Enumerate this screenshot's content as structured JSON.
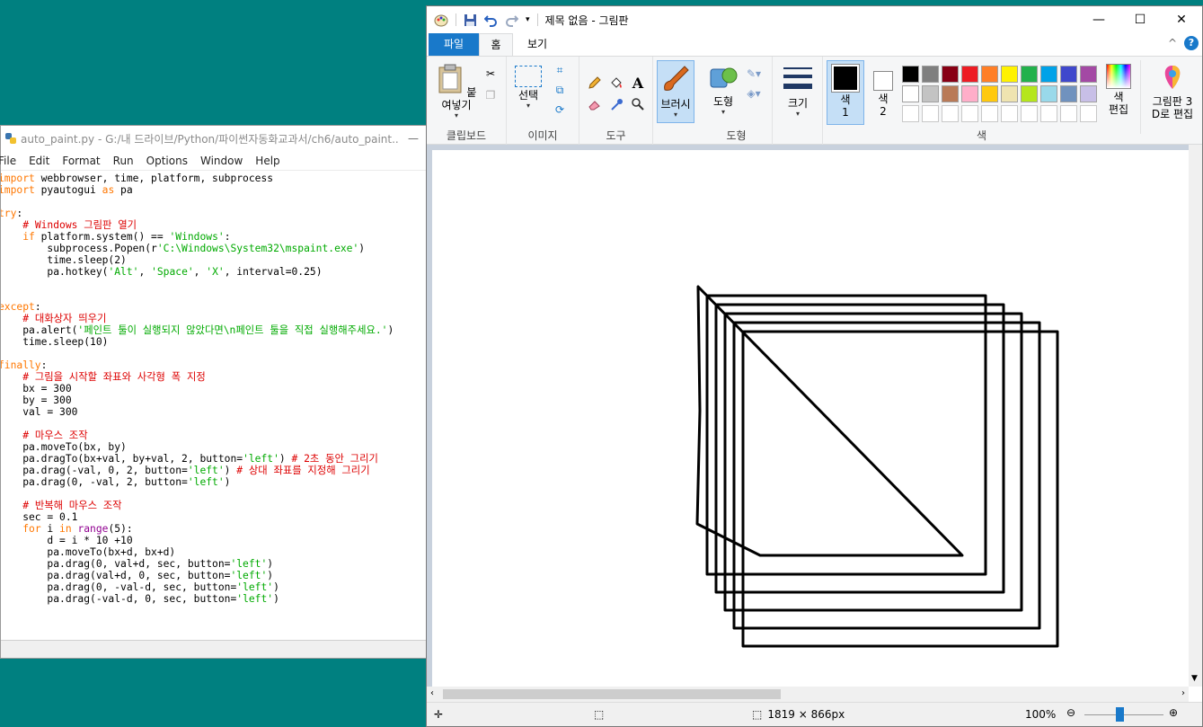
{
  "idle": {
    "title": "auto_paint.py - G:/내 드라이브/Python/파이썬자동화교과서/ch6/auto_paint....",
    "minimize_glyph": "—",
    "menu": [
      "File",
      "Edit",
      "Format",
      "Run",
      "Options",
      "Window",
      "Help"
    ],
    "code_lines": [
      [
        {
          "t": "import",
          "c": "kw"
        },
        {
          "t": " webbrowser, time, platform, subprocess"
        }
      ],
      [
        {
          "t": "import",
          "c": "kw"
        },
        {
          "t": " pyautogui "
        },
        {
          "t": "as",
          "c": "kw"
        },
        {
          "t": " pa"
        }
      ],
      [],
      [
        {
          "t": "try",
          "c": "kw"
        },
        {
          "t": ":"
        }
      ],
      [
        {
          "t": "    "
        },
        {
          "t": "# Windows 그림판 열기",
          "c": "cm"
        }
      ],
      [
        {
          "t": "    "
        },
        {
          "t": "if",
          "c": "kw"
        },
        {
          "t": " platform.system() == "
        },
        {
          "t": "'Windows'",
          "c": "st"
        },
        {
          "t": ":"
        }
      ],
      [
        {
          "t": "        subprocess.Popen(r"
        },
        {
          "t": "'C:\\Windows\\System32\\mspaint.exe'",
          "c": "st"
        },
        {
          "t": ")"
        }
      ],
      [
        {
          "t": "        time.sleep(2)"
        }
      ],
      [
        {
          "t": "        pa.hotkey("
        },
        {
          "t": "'Alt'",
          "c": "st"
        },
        {
          "t": ", "
        },
        {
          "t": "'Space'",
          "c": "st"
        },
        {
          "t": ", "
        },
        {
          "t": "'X'",
          "c": "st"
        },
        {
          "t": ", interval=0.25)"
        }
      ],
      [],
      [],
      [
        {
          "t": "except",
          "c": "kw"
        },
        {
          "t": ":"
        }
      ],
      [
        {
          "t": "    "
        },
        {
          "t": "# 대화상자 띄우기",
          "c": "cm"
        }
      ],
      [
        {
          "t": "    pa.alert("
        },
        {
          "t": "'페인트 툴이 실행되지 않았다면\\n페인트 툴을 직접 실행해주세요.'",
          "c": "st"
        },
        {
          "t": ")"
        }
      ],
      [
        {
          "t": "    time.sleep(10)"
        }
      ],
      [],
      [
        {
          "t": "finally",
          "c": "kw"
        },
        {
          "t": ":"
        }
      ],
      [
        {
          "t": "    "
        },
        {
          "t": "# 그림을 시작할 좌표와 사각형 폭 지정",
          "c": "cm"
        }
      ],
      [
        {
          "t": "    bx = 300"
        }
      ],
      [
        {
          "t": "    by = 300"
        }
      ],
      [
        {
          "t": "    val = 300"
        }
      ],
      [],
      [
        {
          "t": "    "
        },
        {
          "t": "# 마우스 조작",
          "c": "cm"
        }
      ],
      [
        {
          "t": "    pa.moveTo(bx, by)"
        }
      ],
      [
        {
          "t": "    pa.dragTo(bx+val, by+val, 2, button="
        },
        {
          "t": "'left'",
          "c": "st"
        },
        {
          "t": ") "
        },
        {
          "t": "# 2초 동안 그리기",
          "c": "cm"
        }
      ],
      [
        {
          "t": "    pa.drag(-val, 0, 2, button="
        },
        {
          "t": "'left'",
          "c": "st"
        },
        {
          "t": ") "
        },
        {
          "t": "# 상대 좌표를 지정해 그리기",
          "c": "cm"
        }
      ],
      [
        {
          "t": "    pa.drag(0, -val, 2, button="
        },
        {
          "t": "'left'",
          "c": "st"
        },
        {
          "t": ")"
        }
      ],
      [],
      [
        {
          "t": "    "
        },
        {
          "t": "# 반복해 마우스 조작",
          "c": "cm"
        }
      ],
      [
        {
          "t": "    sec = 0.1"
        }
      ],
      [
        {
          "t": "    "
        },
        {
          "t": "for",
          "c": "kw"
        },
        {
          "t": " i "
        },
        {
          "t": "in",
          "c": "kw"
        },
        {
          "t": " "
        },
        {
          "t": "range",
          "c": "bi"
        },
        {
          "t": "(5):"
        }
      ],
      [
        {
          "t": "        d = i * 10 +10"
        }
      ],
      [
        {
          "t": "        pa.moveTo(bx+d, bx+d)"
        }
      ],
      [
        {
          "t": "        pa.drag(0, val+d, sec, button="
        },
        {
          "t": "'left'",
          "c": "st"
        },
        {
          "t": ")"
        }
      ],
      [
        {
          "t": "        pa.drag(val+d, 0, sec, button="
        },
        {
          "t": "'left'",
          "c": "st"
        },
        {
          "t": ")"
        }
      ],
      [
        {
          "t": "        pa.drag(0, -val-d, sec, button="
        },
        {
          "t": "'left'",
          "c": "st"
        },
        {
          "t": ")"
        }
      ],
      [
        {
          "t": "        pa.drag(-val-d, 0, sec, button="
        },
        {
          "t": "'left'",
          "c": "st"
        },
        {
          "t": ")"
        }
      ]
    ]
  },
  "paint": {
    "title": "제목 없음 - 그림판",
    "tabs": {
      "file": "파일",
      "home": "홈",
      "view": "보기"
    },
    "groups": {
      "clipboard": {
        "label": "클립보드",
        "paste": "붙여넣기"
      },
      "image": {
        "label": "이미지",
        "select": "선택"
      },
      "tools": {
        "label": "도구"
      },
      "brushes": {
        "label": "브러시"
      },
      "shapes": {
        "label": "도형",
        "shapes_btn": "도형"
      },
      "size": {
        "label": "크기"
      },
      "colors": {
        "label": "색",
        "color1": "색\n1",
        "color2": "색\n2",
        "edit": "색\n편집",
        "paint3d": "그림판 3\nD로 편집",
        "row1": [
          "#000000",
          "#7f7f7f",
          "#880015",
          "#ed1c24",
          "#ff7f27",
          "#fff200",
          "#22b14c",
          "#00a2e8",
          "#3f48cc",
          "#a349a4"
        ],
        "row2": [
          "#ffffff",
          "#c3c3c3",
          "#b97a57",
          "#ffaec9",
          "#ffc90e",
          "#efe4b0",
          "#b5e61d",
          "#99d9ea",
          "#7092be",
          "#c8bfe7"
        ]
      }
    },
    "status": {
      "canvas_size": "1819 × 866px",
      "zoom": "100%"
    }
  }
}
